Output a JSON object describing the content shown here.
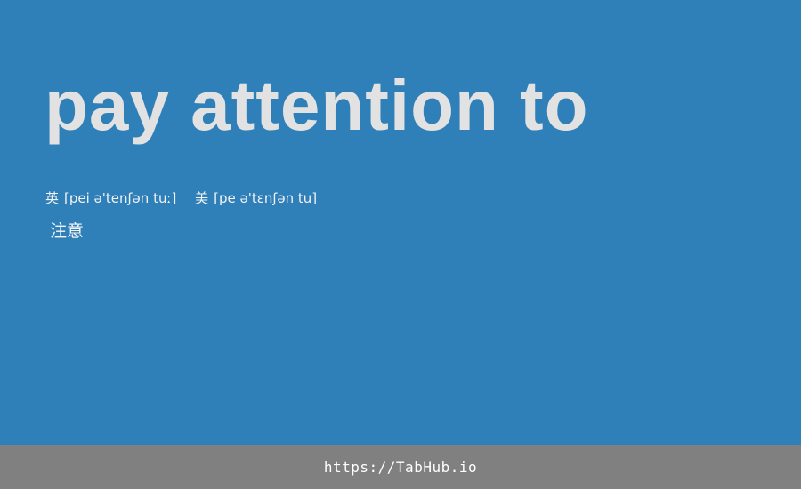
{
  "entry": {
    "word": "pay attention to",
    "phonetics": {
      "uk_tag": "英",
      "uk": "[pei ə'tenʃən tuː]",
      "us_tag": "美",
      "us": "[pe ə'tɛnʃən tu]"
    },
    "meaning": "注意"
  },
  "footer": {
    "link_text": "https://TabHub.io"
  },
  "colors": {
    "background": "#2f80b8",
    "word_text": "#e2e2e2",
    "footer_background": "#808080"
  }
}
